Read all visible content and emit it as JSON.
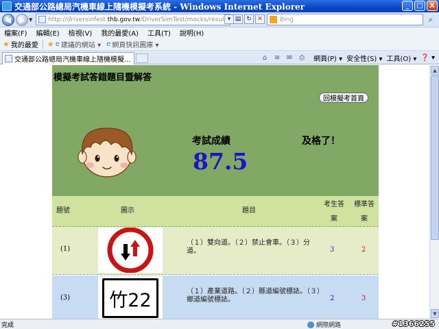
{
  "window": {
    "title": "交通部公路總局汽機車線上隨機模擬考系統 - Windows Internet Explorer",
    "minimize": "_",
    "maximize": "□",
    "close": "X"
  },
  "address": {
    "url_prefix": "http://driversinfest.",
    "url_host": "thb.gov.tw",
    "url_suffix": "/DriverSimTest/mocks/result.do",
    "search_placeholder": "Bing"
  },
  "menu": [
    "檔案(F)",
    "編輯(E)",
    "檢視(V)",
    "我的最愛(A)",
    "工具(T)",
    "說明(H)"
  ],
  "favorites": {
    "label": "我的最愛",
    "links": [
      "建議的網站 ▾",
      "網頁快訊圖庫 ▾"
    ]
  },
  "tab": {
    "label": "交通部公路總局汽機車線上隨機模擬..."
  },
  "commandbar": [
    "網頁(P) ▾",
    "安全性(S) ▾",
    "工具(O) ▾",
    "❓ ▾"
  ],
  "page": {
    "heading": "模擬考試答錯題目暨解答",
    "home_button": "回模擬考首頁",
    "score_label": "考試成績",
    "score": "87.5",
    "result_text": "及格了！",
    "columns": {
      "no": "題號",
      "image": "圖示",
      "question": "題目",
      "my_answer": "考生答案",
      "std_answer": "標準答案"
    },
    "rows": [
      {
        "no": "(1)",
        "sign": "two-way-traffic",
        "question": "（１）雙向道。（２）禁止會車。（３）分道。",
        "my_answer": "3",
        "std_answer": "2"
      },
      {
        "no": "(3)",
        "sign": "竹22",
        "question": "（１）產業道路。（２）縣道編號標誌。（３）鄉道編號標誌。",
        "my_answer": "2",
        "std_answer": "3"
      }
    ]
  },
  "status": {
    "text": "完成",
    "zone": "網際網路",
    "watermark": "#1366255"
  },
  "colors": {
    "panel_green": "#82a866",
    "header_green": "#cfe39e",
    "score_blue": "#1d14c8",
    "answer_red": "#cc1111"
  }
}
